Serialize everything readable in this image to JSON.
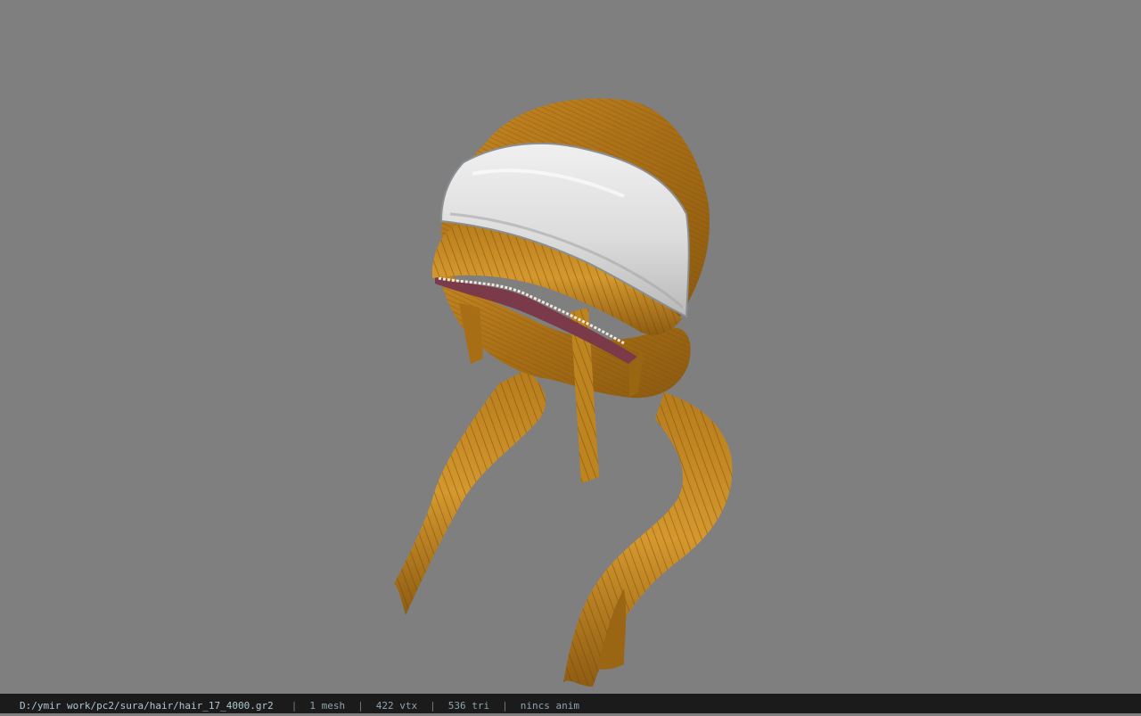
{
  "viewer": {
    "background_color": "#7f7f7f",
    "model": {
      "subject": "hair mesh with white headband and two ponytails",
      "hair_color": "#b07a1c",
      "headband_color": "#e8e8e8"
    }
  },
  "status_bar": {
    "file_path": "D:/ymir work/pc2/sura/hair/hair_17_4000.gr2",
    "separator": "|",
    "mesh_count": "1 mesh",
    "vertex_count": "422 vtx",
    "triangle_count": "536 tri",
    "anim_info": "nincs anim"
  }
}
